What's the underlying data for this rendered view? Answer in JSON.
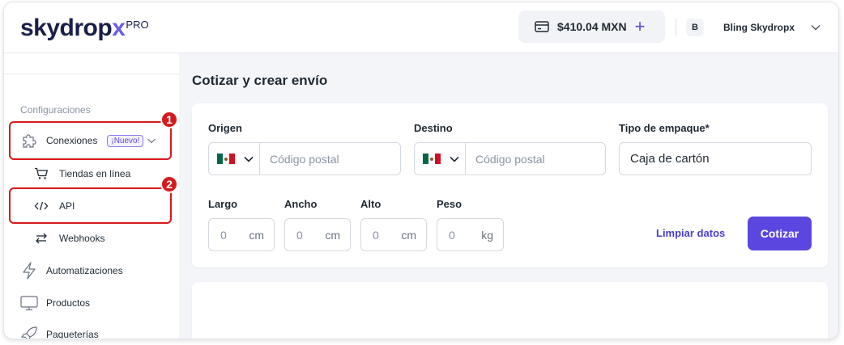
{
  "brand": {
    "name_main": "skydrop",
    "name_accent": "x",
    "tier": "PRO"
  },
  "header": {
    "balance": "$410.04 MXN",
    "add_symbol": "+",
    "avatar_initial": "B",
    "account_name": "Bling Skydropx"
  },
  "sidebar": {
    "section_label": "Configuraciones",
    "conexiones": {
      "label": "Conexiones",
      "badge": "¡Nuevo!"
    },
    "subitems": [
      {
        "label": "Tiendas en línea",
        "icon": "cart-icon"
      },
      {
        "label": "API",
        "icon": "code-icon"
      },
      {
        "label": "Webhooks",
        "icon": "swap-arrows-icon"
      }
    ],
    "items": [
      {
        "label": "Automatizaciones",
        "icon": "lightning-icon"
      },
      {
        "label": "Productos",
        "icon": "monitor-icon"
      },
      {
        "label": "Paqueterías",
        "icon": "rocket-icon"
      }
    ]
  },
  "annotations": {
    "marker_1": "1",
    "marker_2": "2"
  },
  "main": {
    "title": "Cotizar y crear envío",
    "origin": {
      "label": "Origen",
      "placeholder": "Código postal"
    },
    "destination": {
      "label": "Destino",
      "placeholder": "Código postal"
    },
    "packaging": {
      "label": "Tipo de empaque*",
      "value": "Caja de cartón"
    },
    "dimensions": [
      {
        "label": "Largo",
        "value": "0",
        "unit": "cm"
      },
      {
        "label": "Ancho",
        "value": "0",
        "unit": "cm"
      },
      {
        "label": "Alto",
        "value": "0",
        "unit": "cm"
      },
      {
        "label": "Peso",
        "value": "0",
        "unit": "kg"
      }
    ],
    "clear_button": "Limpiar datos",
    "quote_button": "Cotizar"
  },
  "colors": {
    "brand_navy": "#1a1f4a",
    "accent": "#5b47e0",
    "highlight": "#d7191c",
    "background": "#f3f5f9"
  }
}
